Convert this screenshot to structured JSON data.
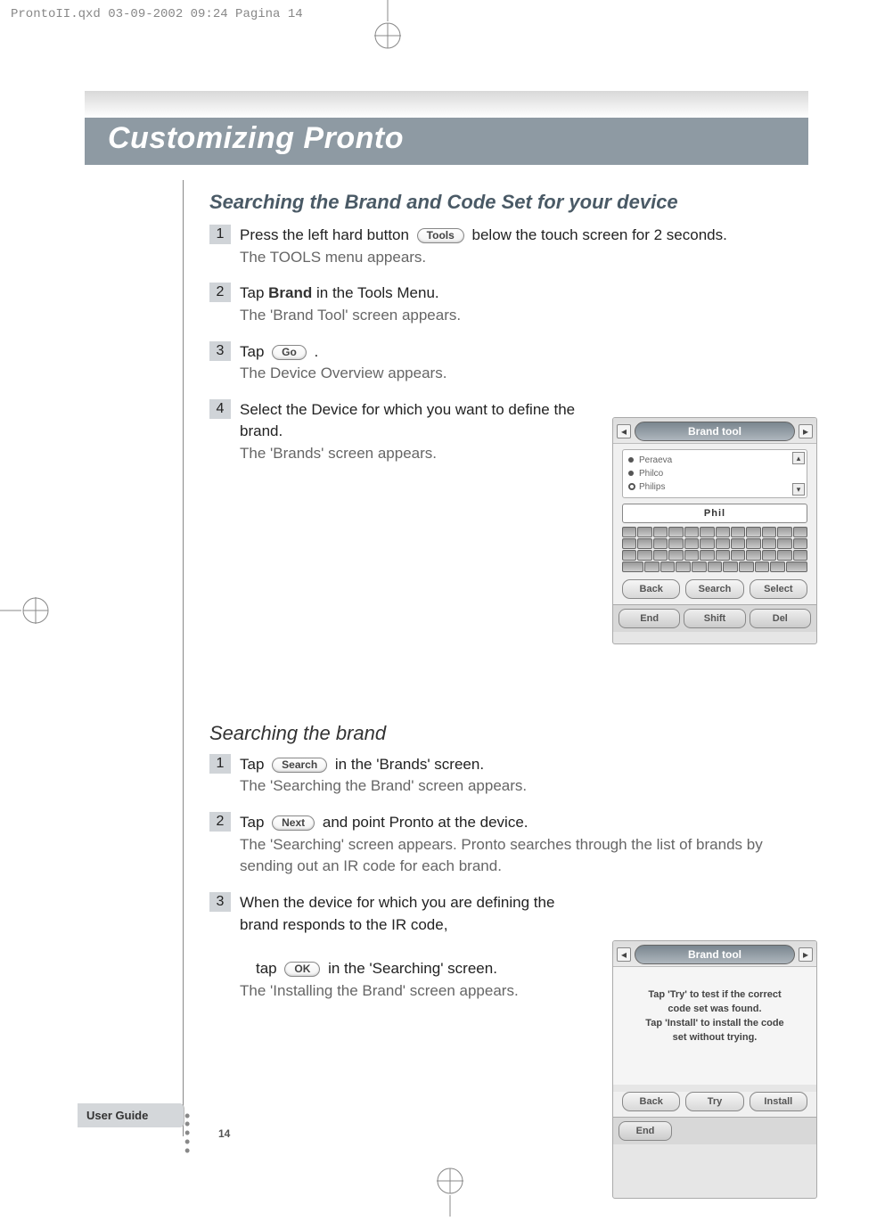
{
  "print_header": "ProntoII.qxd   03-09-2002   09:24   Pagina 14",
  "banner_title": "Customizing Pronto",
  "section_title": "Searching the Brand and Code Set for your device",
  "stepsA": [
    {
      "num": "1",
      "pre": "Press the left hard button ",
      "btn": "Tools",
      "post": " below the touch screen for 2 seconds.",
      "sub": "The TOOLS menu appears."
    },
    {
      "num": "2",
      "text_a": "Tap ",
      "bold": "Brand",
      "text_b": " in the Tools Menu.",
      "sub": "The 'Brand Tool' screen appears."
    },
    {
      "num": "3",
      "pre": "Tap ",
      "btn": "Go",
      "post": " .",
      "sub": "The Device Overview appears."
    },
    {
      "num": "4",
      "text": "Select the Device for which you want to define the brand.",
      "sub": "The 'Brands' screen appears."
    }
  ],
  "sub_title": "Searching the brand",
  "stepsB": [
    {
      "num": "1",
      "pre": "Tap ",
      "btn": "Search",
      "post": " in the 'Brands' screen.",
      "sub": "The 'Searching the Brand' screen appears."
    },
    {
      "num": "2",
      "pre": "Tap ",
      "btn": "Next",
      "post": " and point Pronto at the device.",
      "sub": "The 'Searching' screen appears. Pronto searches through the list of brands by sending out an IR code for each brand."
    },
    {
      "num": "3",
      "text": "When the device for which you are defining the brand responds to the IR code,",
      "pre2": "tap ",
      "btn2": "OK",
      "post2": " in the 'Searching' screen.",
      "sub": "The 'Installing the Brand' screen appears."
    }
  ],
  "screenshot_top": {
    "title": "Brand tool",
    "list": [
      "Peraeva",
      "Philco",
      "Philips"
    ],
    "input": "Phil",
    "soft": [
      "Back",
      "Search",
      "Select"
    ],
    "hard": [
      "End",
      "Shift",
      "Del"
    ]
  },
  "screenshot_bottom": {
    "title": "Brand tool",
    "msg1": "Tap 'Try' to test if the correct",
    "msg2": "code set was found.",
    "msg3": "Tap 'Install' to install the code",
    "msg4": "set without trying.",
    "soft": [
      "Back",
      "Try",
      "Install"
    ],
    "hard": [
      "End"
    ]
  },
  "user_guide": "User Guide",
  "page_number": "14"
}
